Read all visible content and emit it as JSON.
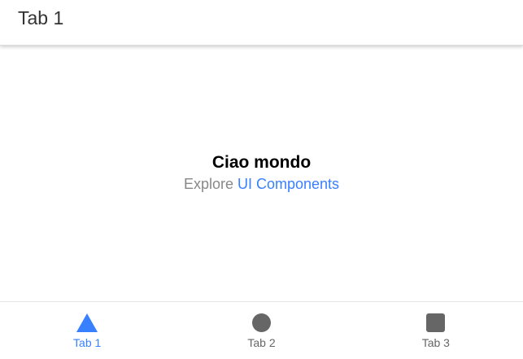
{
  "header": {
    "title": "Tab 1"
  },
  "main": {
    "title": "Ciao mondo",
    "explore": "Explore",
    "link": "UI Components"
  },
  "tabs": [
    {
      "label": "Tab 1",
      "icon": "triangle-icon",
      "active": true
    },
    {
      "label": "Tab 2",
      "icon": "ellipse-icon",
      "active": false
    },
    {
      "label": "Tab 3",
      "icon": "square-icon",
      "active": false
    }
  ],
  "colors": {
    "accent": "#3880ff",
    "inactive": "#666666"
  }
}
